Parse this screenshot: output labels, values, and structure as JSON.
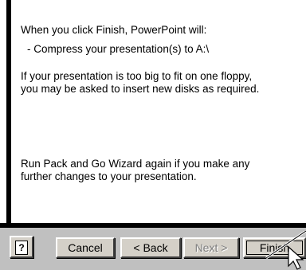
{
  "content": {
    "line1": "When you click Finish, PowerPoint will:",
    "line2": "- Compress your presentation(s) to A:\\",
    "line3": "If your presentation is too big to fit on one floppy, you may be asked to insert new disks as required.",
    "line4": "Run Pack and Go Wizard again if you make any further changes to your presentation."
  },
  "buttons": {
    "help": "?",
    "cancel": "Cancel",
    "back": "< Back",
    "next": "Next >",
    "finish": "Finish"
  },
  "states": {
    "next_enabled": false
  },
  "icons": {
    "help": "help-icon",
    "pointer": "arrow-pointer-icon"
  }
}
